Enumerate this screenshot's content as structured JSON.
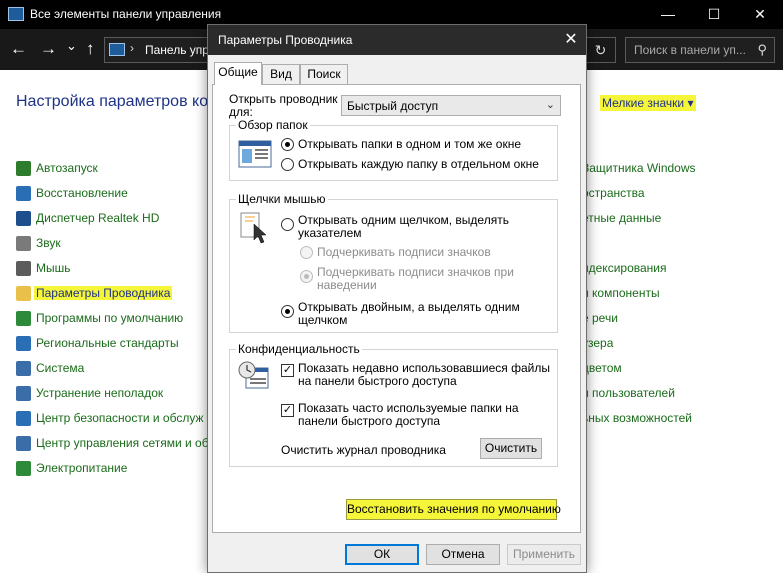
{
  "colors": {
    "highlight": "#f5f53a",
    "link_green": "#1a6b1a",
    "heading_blue": "#1e3287",
    "titlebar": "#000000"
  },
  "control_panel": {
    "title": "Все элементы панели управления",
    "window_buttons": {
      "minimize": "—",
      "maximize": "☐",
      "close": "✕"
    },
    "nav": {
      "back": "←",
      "forward": "→",
      "dropdown": "⌄",
      "up": "↑"
    },
    "address": {
      "separator": "›",
      "text": "Панель упр"
    },
    "refresh": "↻",
    "search_placeholder": "Поиск в панели уп...",
    "search_icon": "search-icon",
    "heading": "Настройка параметров ком",
    "view_by": "Мелкие значки",
    "view_by_arrow": "▾",
    "left_items": [
      {
        "label": "Автозапуск",
        "icon": "autoplay-icon",
        "color": "#2d7d2d"
      },
      {
        "label": "Восстановление",
        "icon": "recovery-icon",
        "color": "#2a6fb5"
      },
      {
        "label": "Диспетчер Realtek HD",
        "icon": "realtek-icon",
        "color": "#1f4e8c"
      },
      {
        "label": "Звук",
        "icon": "sound-icon",
        "color": "#7a7a7a"
      },
      {
        "label": "Мышь",
        "icon": "mouse-icon",
        "color": "#5c5c5c"
      },
      {
        "label": "Параметры Проводника",
        "icon": "folder-options-icon",
        "color": "#e8c04a"
      },
      {
        "label": "Программы по умолчанию",
        "icon": "default-programs-icon",
        "color": "#2d8a3a"
      },
      {
        "label": "Региональные стандарты",
        "icon": "region-icon",
        "color": "#2a6fb5"
      },
      {
        "label": "Система",
        "icon": "system-icon",
        "color": "#3b6ea8"
      },
      {
        "label": "Устранение неполадок",
        "icon": "troubleshoot-icon",
        "color": "#3b6ea8"
      },
      {
        "label": "Центр безопасности и обслуж",
        "icon": "security-flag-icon",
        "color": "#2a6fb5"
      },
      {
        "label": "Центр управления сетями и об",
        "icon": "network-icon",
        "color": "#3b6ea8"
      },
      {
        "label": "Электропитание",
        "icon": "power-icon",
        "color": "#2d8a3a"
      }
    ],
    "right_items": [
      "Защитника Windows",
      "остранства",
      "етные данные",
      "",
      "ндексирования",
      "и компоненты",
      "е речи",
      "узера",
      "цветом",
      "и пользователей",
      "ьных возможностей"
    ]
  },
  "dialog": {
    "title": "Параметры Проводника",
    "close": "✕",
    "tabs": [
      "Общие",
      "Вид",
      "Поиск"
    ],
    "open_explorer_label": "Открыть проводник для:",
    "open_explorer_value": "Быстрый доступ",
    "select_arrow": "⌄",
    "browse": {
      "title": "Обзор папок",
      "options": [
        "Открывать папки в одном и том же окне",
        "Открывать каждую папку в отдельном окне"
      ],
      "selected": 0
    },
    "click": {
      "title": "Щелчки мышью",
      "single": "Открывать одним щелчком, выделять указателем",
      "underline_always": "Подчеркивать подписи значков",
      "underline_hover": "Подчеркивать подписи значков при наведении",
      "double": "Открывать двойным, а выделять одним щелчком",
      "selected": "double"
    },
    "privacy": {
      "title": "Конфиденциальность",
      "recent_files": "Показать недавно использовавшиеся файлы на панели быстрого доступа",
      "frequent_folders": "Показать часто используемые папки на панели быстрого доступа",
      "check_mark": "✓",
      "clear_label": "Очистить журнал проводника",
      "clear_button": "Очистить"
    },
    "restore_defaults": "Восстановить значения по умолчанию",
    "buttons": {
      "ok": "ОК",
      "cancel": "Отмена",
      "apply": "Применить"
    }
  }
}
